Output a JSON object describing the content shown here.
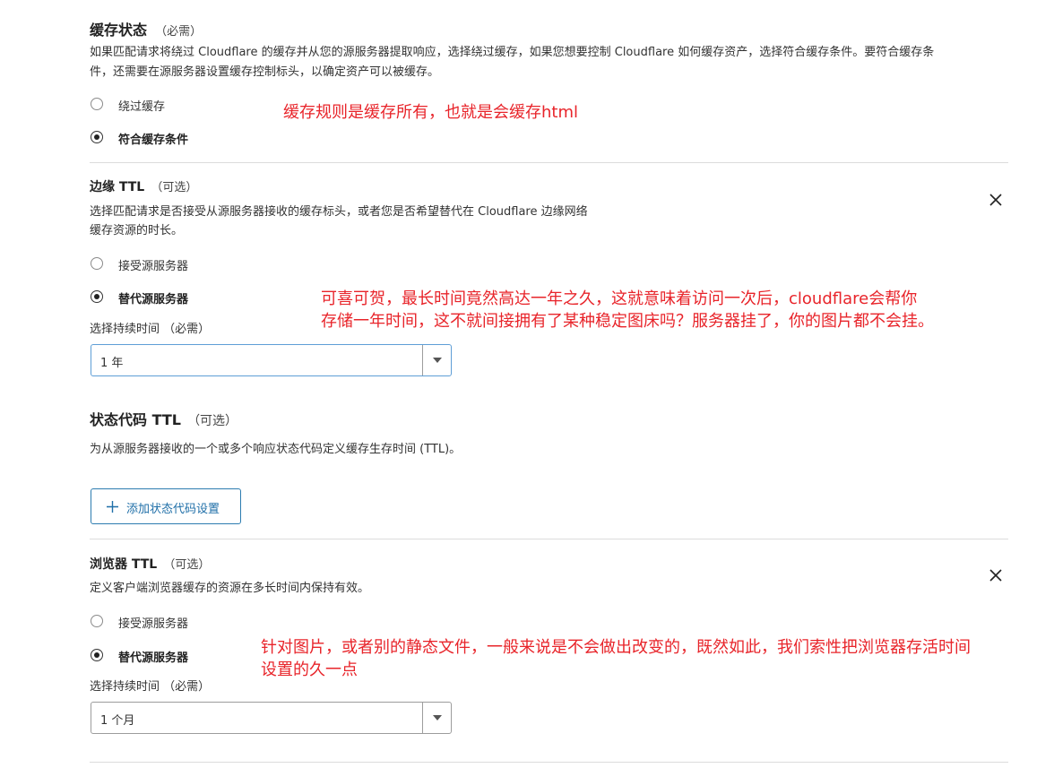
{
  "cache_status": {
    "title": "缓存状态",
    "required": "（必需）",
    "desc_line1": "如果匹配请求将绕过 Cloudflare 的缓存并从您的源服务器提取响应，选择绕过缓存，如果您想要控制 Cloudflare 如何缓存资产，选择符合缓存条件。要符合缓存条",
    "desc_line2": "件，还需要在源服务器设置缓存控制标头，以确定资产可以被缓存。",
    "options": [
      "绕过缓存",
      "符合缓存条件"
    ],
    "selected_index": 1,
    "annotation": "缓存规则是缓存所有，也就是会缓存html"
  },
  "edge_ttl": {
    "title": "边缘 TTL",
    "optional": "（可选）",
    "desc_line1": "选择匹配请求是否接受从源服务器接收的缓存标头，或者您是否希望替代在 Cloudflare 边缘网络",
    "desc_line2": "缓存资源的时长。",
    "options": [
      "接受源服务器",
      "替代源服务器"
    ],
    "selected_index": 1,
    "duration_label": "选择持续时间 （必需）",
    "duration_value": "1 年",
    "annotation_line1": "可喜可贺，最长时间竟然高达一年之久，这就意味着访问一次后，cloudflare会帮你",
    "annotation_line2": "存储一年时间，这不就间接拥有了某种稳定图床吗？服务器挂了，你的图片都不会挂。"
  },
  "status_code_ttl": {
    "title": "状态代码 TTL",
    "optional": "（可选）",
    "desc": "为从源服务器接收的一个或多个响应状态代码定义缓存生存时间 (TTL)。",
    "add_button": "添加状态代码设置"
  },
  "browser_ttl": {
    "title": "浏览器 TTL",
    "optional": "（可选）",
    "desc": "定义客户端浏览器缓存的资源在多长时间内保持有效。",
    "options": [
      "接受源服务器",
      "替代源服务器"
    ],
    "selected_index": 1,
    "duration_label": "选择持续时间 （必需）",
    "duration_value": "1 个月",
    "annotation_line1": "针对图片，或者别的静态文件，一般来说是不会做出改变的，既然如此，我们索性把浏览器存活时间",
    "annotation_line2": "设置的久一点"
  },
  "icons": {
    "close": "close-icon",
    "dropdown": "chevron-down-icon",
    "plus": "plus-icon"
  },
  "colors": {
    "annotation": "#e8242a",
    "accent": "#1f6fa8",
    "focus_border": "#5e9ed6"
  }
}
